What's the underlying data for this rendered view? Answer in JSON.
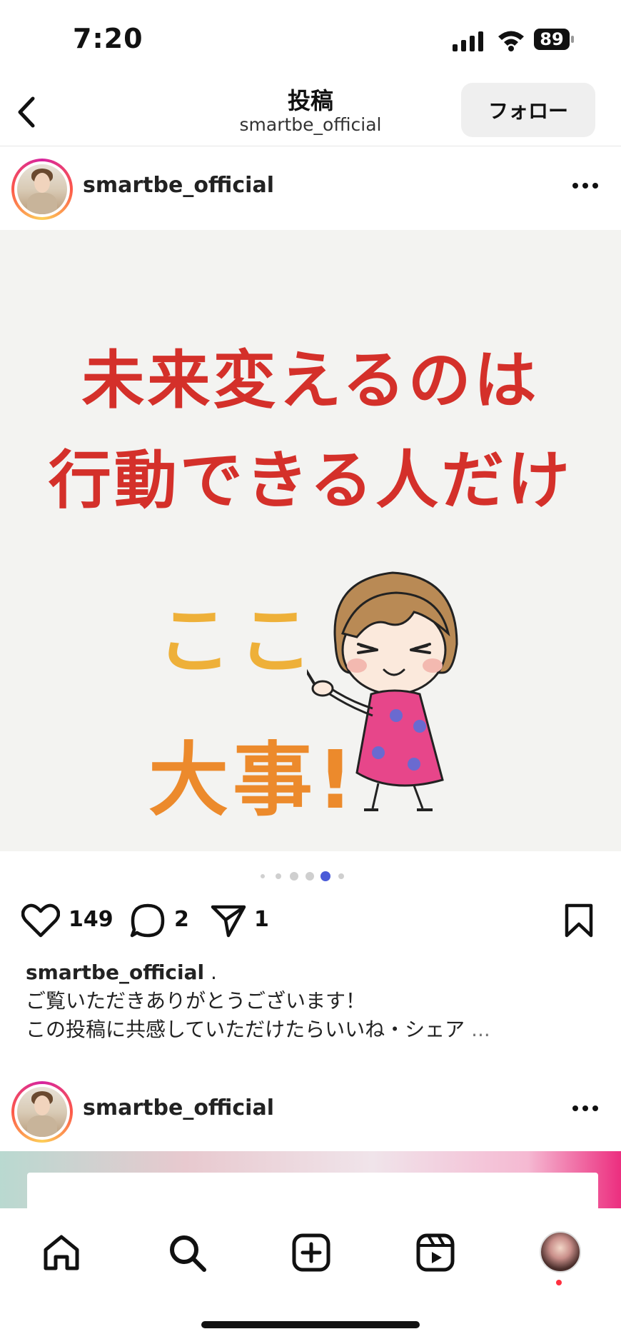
{
  "status_bar": {
    "time": "7:20",
    "battery": "89"
  },
  "header": {
    "title": "投稿",
    "subtitle": "smartbe_official",
    "follow_label": "フォロー"
  },
  "post": {
    "username": "smartbe_official",
    "image_text": {
      "line1": "未来変えるのは",
      "line2": "行動できる人だけ",
      "koko": "ここ",
      "daiji": "大事!"
    },
    "carousel": {
      "count": 6,
      "active_index": 4
    },
    "likes": "149",
    "comments": "2",
    "shares": "1",
    "caption_user": "smartbe_official",
    "caption_suffix": " .",
    "caption_line1": "ご覧いただきありがとうございます！",
    "caption_line2": "この投稿に共感していただけたらいいね・シェア",
    "caption_more": " ..."
  },
  "next_post": {
    "username": "smartbe_official"
  },
  "colors": {
    "headline_red": "#d4302a",
    "koko_yellow": "#eeb039",
    "daiji_orange": "#ec8a2c",
    "notification_dot": "#ff3040",
    "active_dot": "#4a5bd8"
  },
  "bottom_nav": {
    "icons": [
      "home-icon",
      "search-icon",
      "create-icon",
      "reels-icon",
      "profile-avatar"
    ]
  }
}
